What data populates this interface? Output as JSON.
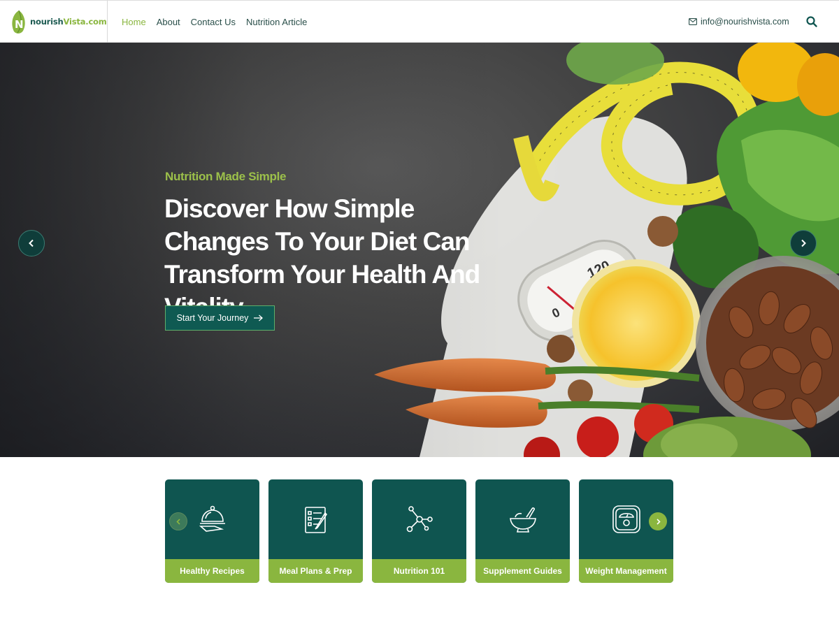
{
  "brand": {
    "name_part1": "nourish",
    "name_part2": "Vista.com",
    "logo_letter": "N"
  },
  "nav": {
    "items": [
      {
        "label": "Home",
        "active": true
      },
      {
        "label": "About",
        "active": false
      },
      {
        "label": "Contact Us",
        "active": false
      },
      {
        "label": "Nutrition Article",
        "active": false
      }
    ]
  },
  "contact": {
    "email": "info@nourishvista.com",
    "icon": "envelope-icon"
  },
  "search": {
    "icon": "search-icon"
  },
  "hero": {
    "subtitle": "Nutrition Made Simple",
    "title": "Discover How Simple Changes To Your Diet Can Transform Your Health And Vitality",
    "cta_label": "Start Your Journey",
    "prev_icon": "chevron-left-icon",
    "next_icon": "chevron-right-icon"
  },
  "categories": [
    {
      "label": "Healthy Recipes",
      "icon": "serving-cloche-icon"
    },
    {
      "label": "Meal Plans & Prep",
      "icon": "checklist-icon"
    },
    {
      "label": "Nutrition 101",
      "icon": "molecule-icon"
    },
    {
      "label": "Supplement Guides",
      "icon": "mortar-pestle-icon"
    },
    {
      "label": "Weight Management",
      "icon": "scale-icon"
    }
  ],
  "colors": {
    "primary": "#0f5550",
    "accent": "#8ab63f",
    "text": "#2a4f4a"
  }
}
